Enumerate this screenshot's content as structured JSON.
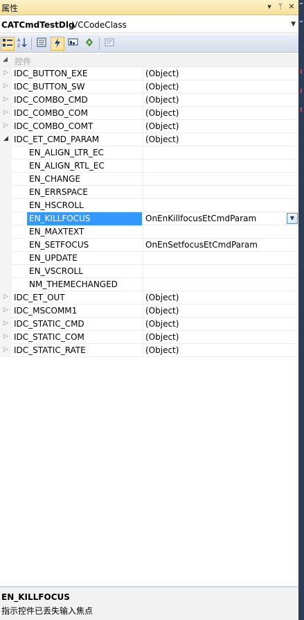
{
  "window": {
    "title": "属性"
  },
  "title_controls": {
    "dropdown": "▾",
    "pin": "ᛘ",
    "close": "✕"
  },
  "object_selector": {
    "name": "CATCmdTestDlg",
    "class": "VCCodeClass"
  },
  "toolbar": {
    "categorized_icon": "categorized-icon",
    "alphabetical_icon": "alphabetical-icon",
    "properties_icon": "properties-icon",
    "events_icon": "events-icon",
    "messages_icon": "messages-icon",
    "overrides_icon": "overrides-icon",
    "property_pages_icon": "property-pages-icon"
  },
  "grid": {
    "category": "控件",
    "items": [
      {
        "name": "IDC_BUTTON_EXE",
        "value": "(Object)",
        "expanded": false
      },
      {
        "name": "IDC_BUTTON_SW",
        "value": "(Object)",
        "expanded": false
      },
      {
        "name": "IDC_COMBO_CMD",
        "value": "(Object)",
        "expanded": false
      },
      {
        "name": "IDC_COMBO_COM",
        "value": "(Object)",
        "expanded": false
      },
      {
        "name": "IDC_COMBO_COMT",
        "value": "(Object)",
        "expanded": false
      },
      {
        "name": "IDC_ET_CMD_PARAM",
        "value": "(Object)",
        "expanded": true
      },
      {
        "name": "IDC_ET_OUT",
        "value": "(Object)",
        "expanded": false
      },
      {
        "name": "IDC_MSCOMM1",
        "value": "(Object)",
        "expanded": false
      },
      {
        "name": "IDC_STATIC_CMD",
        "value": "(Object)",
        "expanded": false
      },
      {
        "name": "IDC_STATIC_COM",
        "value": "(Object)",
        "expanded": false
      },
      {
        "name": "IDC_STATIC_RATE",
        "value": "(Object)",
        "expanded": false
      }
    ],
    "children": [
      {
        "name": "EN_ALIGN_LTR_EC",
        "value": ""
      },
      {
        "name": "EN_ALIGN_RTL_EC",
        "value": ""
      },
      {
        "name": "EN_CHANGE",
        "value": ""
      },
      {
        "name": "EN_ERRSPACE",
        "value": ""
      },
      {
        "name": "EN_HSCROLL",
        "value": ""
      },
      {
        "name": "EN_KILLFOCUS",
        "value": "OnEnKillfocusEtCmdParam",
        "selected": true
      },
      {
        "name": "EN_MAXTEXT",
        "value": ""
      },
      {
        "name": "EN_SETFOCUS",
        "value": "OnEnSetfocusEtCmdParam"
      },
      {
        "name": "EN_UPDATE",
        "value": ""
      },
      {
        "name": "EN_VSCROLL",
        "value": ""
      },
      {
        "name": "NM_THEMECHANGED",
        "value": ""
      }
    ]
  },
  "description": {
    "title": "EN_KILLFOCUS",
    "text": "指示控件已丢失输入焦点"
  },
  "colors": {
    "selection": "#3399ff",
    "titlebar": "#f6df9a",
    "toolbar": "#d5ddeb"
  }
}
